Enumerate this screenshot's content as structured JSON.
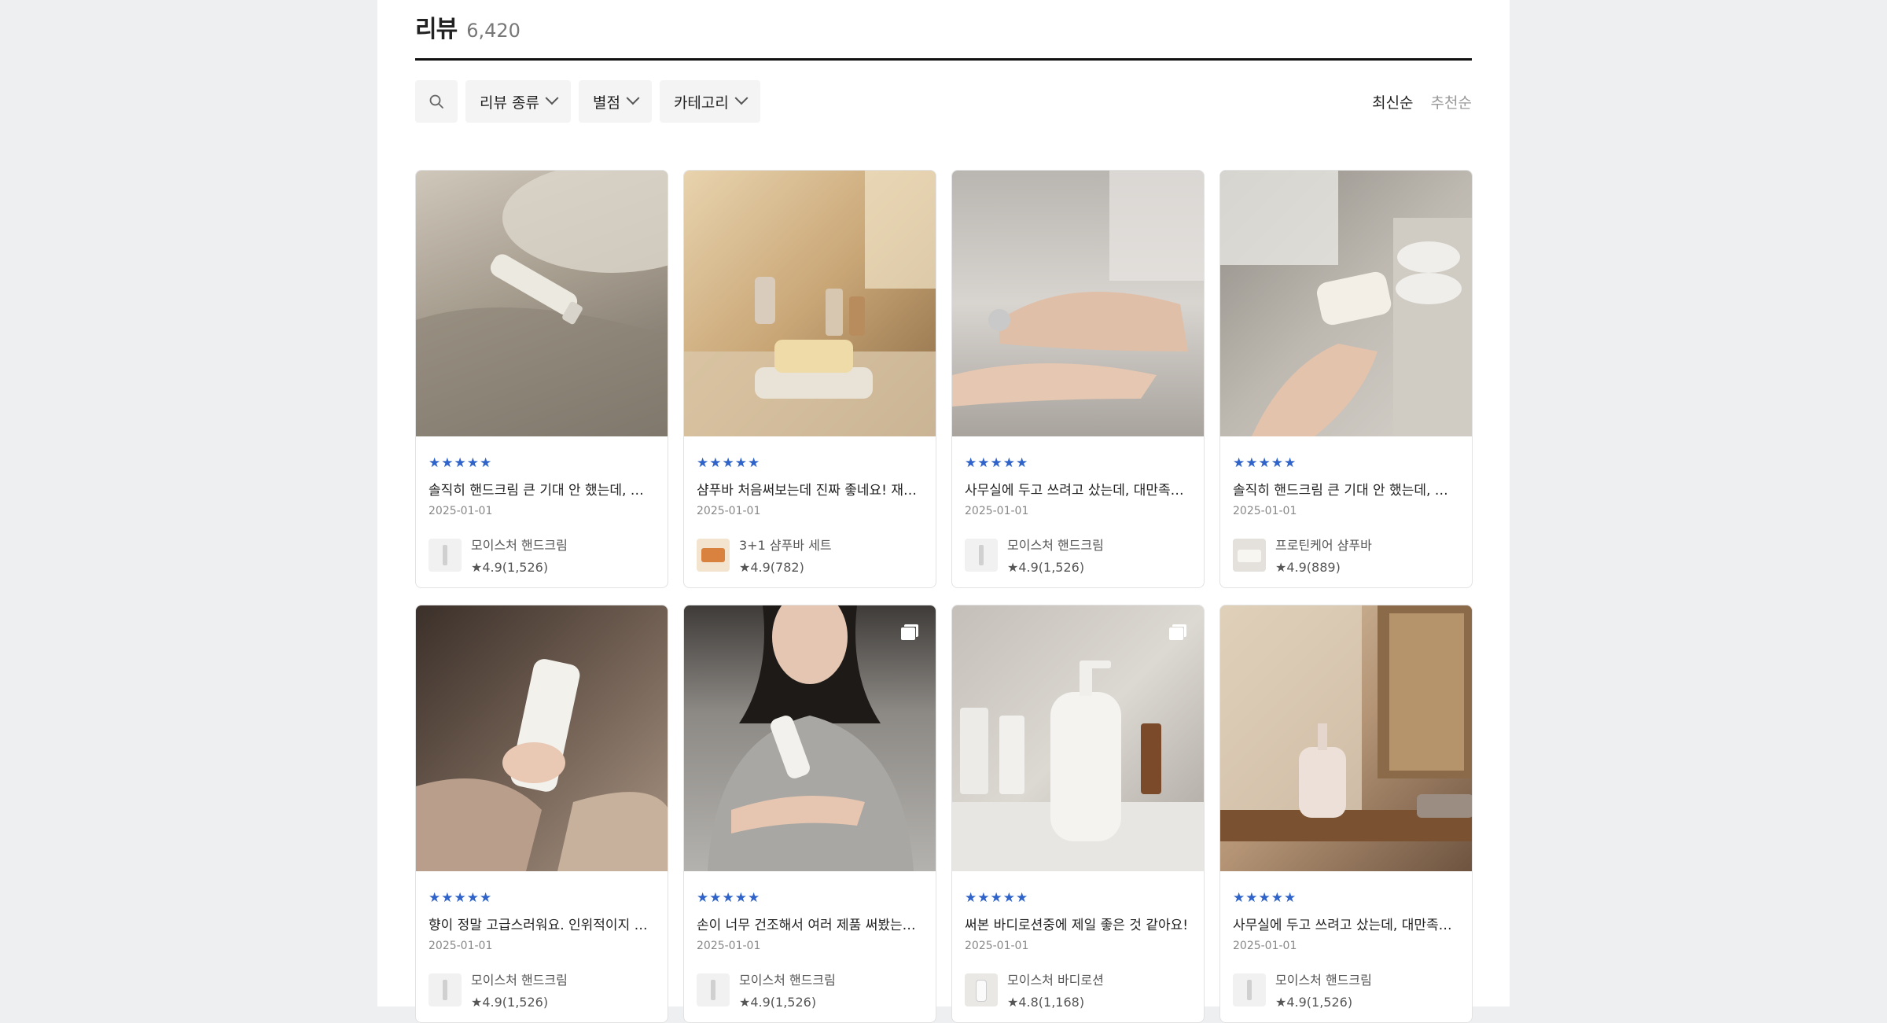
{
  "header": {
    "title": "리뷰",
    "count": "6,420"
  },
  "filters": [
    {
      "label": "리뷰 종류"
    },
    {
      "label": "별점"
    },
    {
      "label": "카테고리"
    }
  ],
  "sort": {
    "latest": "최신순",
    "recommended": "추천순"
  },
  "reviews": [
    {
      "stars": "★★★★★",
      "text": "솔직히 핸드크림 큰 기대 안 했는데, 이건...",
      "date": "2025-01-01",
      "product": "모이스처 핸드크림",
      "rating": "★4.9(1,526)"
    },
    {
      "stars": "★★★★★",
      "text": "샴푸바 처음써보는데 진짜 좋네요! 재구...",
      "date": "2025-01-01",
      "product": "3+1 샴푸바 세트",
      "rating": "★4.9(782)"
    },
    {
      "stars": "★★★★★",
      "text": "사무실에 두고 쓰려고 샀는데, 대만족입...",
      "date": "2025-01-01",
      "product": "모이스처 핸드크림",
      "rating": "★4.9(1,526)"
    },
    {
      "stars": "★★★★★",
      "text": "솔직히 핸드크림 큰 기대 안 했는데, 이건...",
      "date": "2025-01-01",
      "product": "프로틴케어 샴푸바",
      "rating": "★4.9(889)"
    },
    {
      "stars": "★★★★★",
      "text": "향이 정말 고급스러워요. 인위적이지 않...",
      "date": "2025-01-01",
      "product": "모이스처 핸드크림",
      "rating": "★4.9(1,526)"
    },
    {
      "stars": "★★★★★",
      "text": "손이 너무 건조해서 여러 제품 써봤는데,...",
      "date": "2025-01-01",
      "product": "모이스처 핸드크림",
      "rating": "★4.9(1,526)"
    },
    {
      "stars": "★★★★★",
      "text": "써본 바디로션중에 제일 좋은 것 같아요!",
      "date": "2025-01-01",
      "product": "모이스처 바디로션",
      "rating": "★4.8(1,168)"
    },
    {
      "stars": "★★★★★",
      "text": "사무실에 두고 쓰려고 샀는데, 대만족입...",
      "date": "2025-01-01",
      "product": "모이스처 핸드크림",
      "rating": "★4.9(1,526)"
    }
  ]
}
